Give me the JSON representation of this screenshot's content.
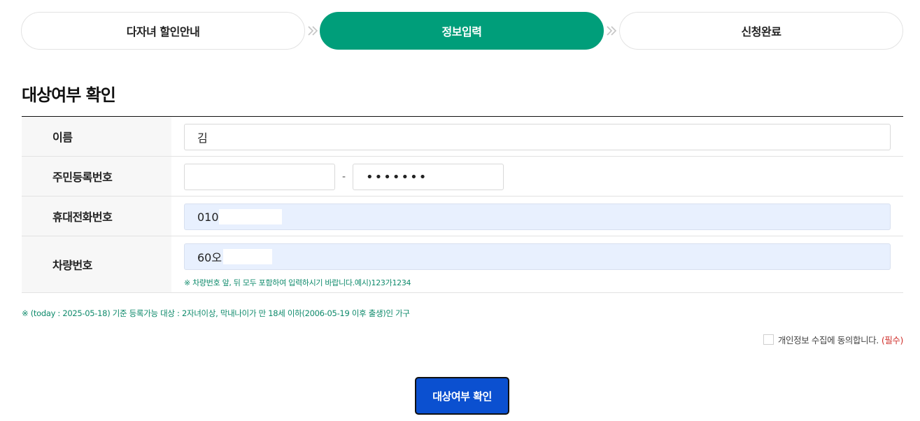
{
  "steps": [
    {
      "label": "다자녀 할인안내",
      "active": false
    },
    {
      "label": "정보입력",
      "active": true
    },
    {
      "label": "신청완료",
      "active": false
    }
  ],
  "section_title": "대상여부 확인",
  "form": {
    "name": {
      "label": "이름",
      "value": "김"
    },
    "rrn": {
      "label": "주민등록번호",
      "front_value": "",
      "separator": "-",
      "back_value": "•••••••"
    },
    "phone": {
      "label": "휴대전화번호",
      "value": "010("
    },
    "car": {
      "label": "차량번호",
      "value": "60오",
      "hint": "※ 차량번호 앞, 뒤 모두 포함하여 입력하시기 바랍니다.예시)123가1234"
    }
  },
  "notice": "※ (today : 2025-05-18) 기준 등록가능 대상 : 2자녀이상, 막내나이가 만 18세 이하(2006-05-19 이후 출생)인 가구",
  "consent": {
    "label": "개인정보 수집에 동의합니다.",
    "required": "(필수)",
    "checked": false
  },
  "submit_label": "대상여부 확인",
  "colors": {
    "active_step": "#009e7a",
    "hint_text": "#0e8a6b",
    "required": "#d0312d",
    "submit_button": "#0b50d0",
    "autofill_bg": "#e8f0fe"
  }
}
